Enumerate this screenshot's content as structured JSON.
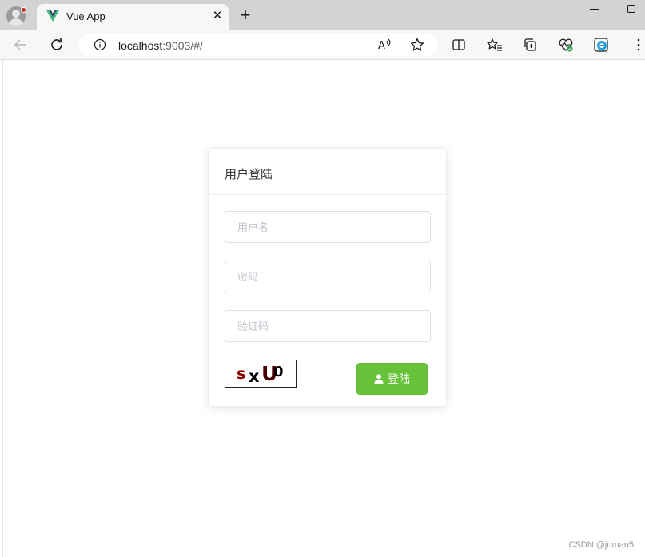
{
  "browser": {
    "tab_title": "Vue App",
    "address_host": "localhost",
    "address_rest": ":9003/#/"
  },
  "login": {
    "title": "用户登陆",
    "username_placeholder": "用户名",
    "password_placeholder": "密码",
    "captcha_placeholder": "验证码",
    "captcha_chars": [
      "s",
      "x",
      "U",
      "0"
    ],
    "captcha_colors": [
      "#8b0000",
      "#000000",
      "#4a0000",
      "#000000"
    ],
    "login_button": "登陆"
  },
  "watermark": "CSDN @joman5",
  "colors": {
    "accent": "#67c23a",
    "vue_green": "#41b883",
    "vue_dark": "#35495e"
  }
}
